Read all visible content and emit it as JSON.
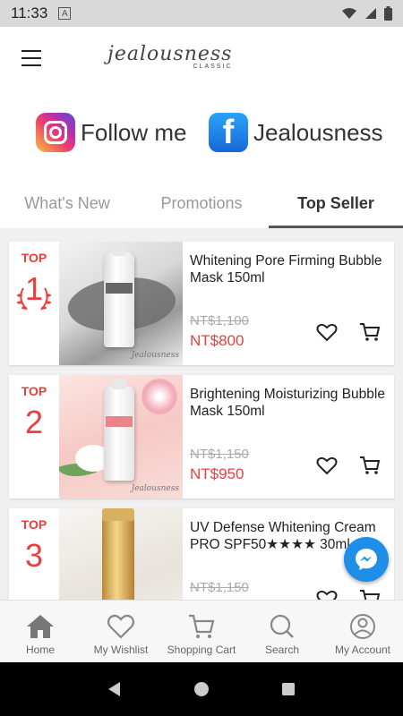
{
  "status_bar": {
    "time": "11:33",
    "notification_letter": "A"
  },
  "header": {
    "brand": "Jealousness",
    "brand_sub": "CLASSIC"
  },
  "social": {
    "instagram_label": "Follow me",
    "facebook_label": "Jealousness"
  },
  "tabs": [
    {
      "label": "What's New",
      "active": false
    },
    {
      "label": "Promotions",
      "active": false
    },
    {
      "label": "Top Seller",
      "active": true
    }
  ],
  "products": [
    {
      "rank_tag": "TOP",
      "rank": "1",
      "name": "Whitening Pore Firming Bubble Mask 150ml",
      "old_price": "NT$1,100",
      "price": "NT$800",
      "image_signature": "Jealousness"
    },
    {
      "rank_tag": "TOP",
      "rank": "2",
      "name": "Brightening Moisturizing Bubble Mask 150ml",
      "old_price": "NT$1,150",
      "price": "NT$950",
      "image_signature": "Jealousness"
    },
    {
      "rank_tag": "TOP",
      "rank": "3",
      "name": "UV Defense Whitening Cream PRO SPF50★★★★ 30ml",
      "old_price": "NT$1,150",
      "price": "",
      "image_signature": ""
    }
  ],
  "bottom_nav": [
    {
      "label": "Home",
      "icon": "home-icon"
    },
    {
      "label": "My Wishlist",
      "icon": "heart-icon"
    },
    {
      "label": "Shopping Cart",
      "icon": "cart-icon"
    },
    {
      "label": "Search",
      "icon": "search-icon"
    },
    {
      "label": "My Account",
      "icon": "account-icon"
    }
  ],
  "colors": {
    "accent_red": "#e9403f",
    "messenger_blue": "#1f8ee8"
  }
}
